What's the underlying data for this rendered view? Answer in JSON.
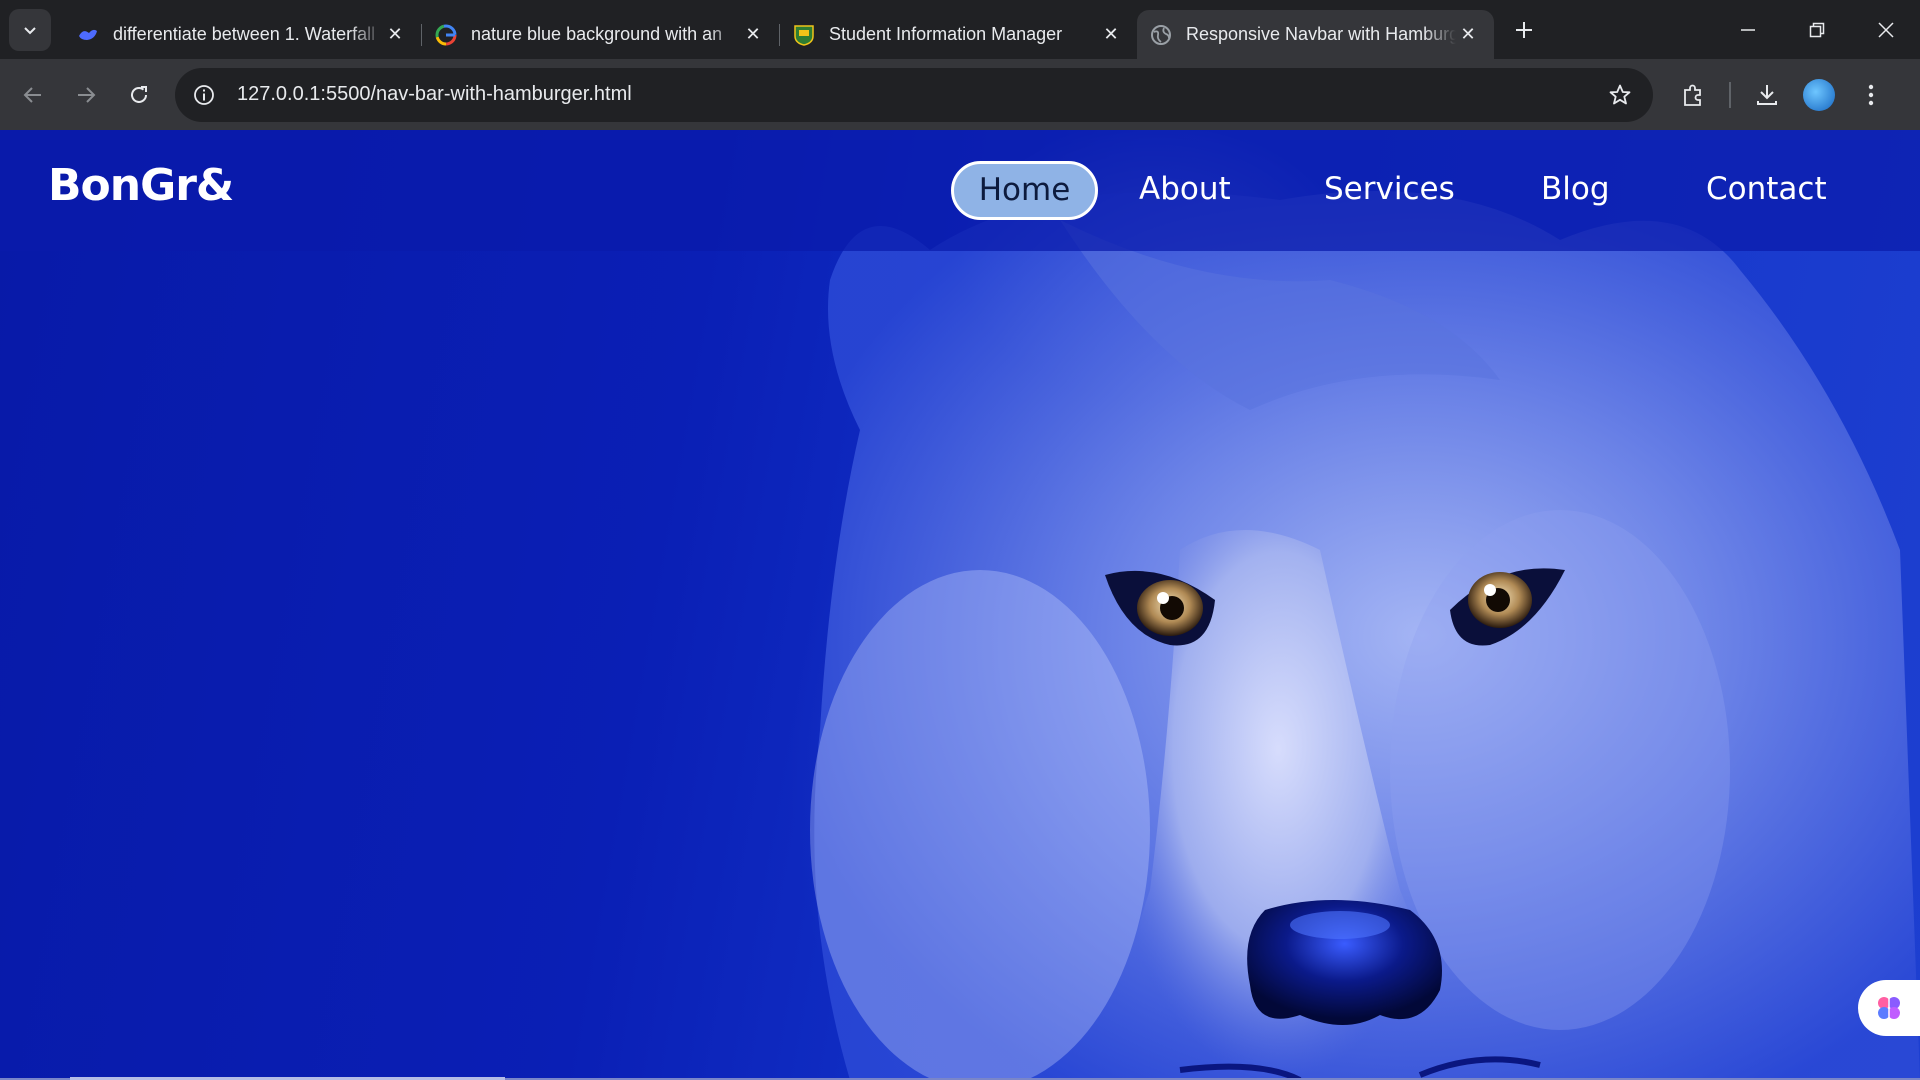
{
  "browser": {
    "tabs": [
      {
        "title": "differentiate between 1. Waterfall",
        "favicon": "whale-icon",
        "active": false
      },
      {
        "title": "nature blue background with an",
        "favicon": "google-icon",
        "active": false
      },
      {
        "title": "Student Information Manager",
        "favicon": "crest-icon",
        "active": false
      },
      {
        "title": "Responsive Navbar with Hamburger",
        "favicon": "globe-icon",
        "active": true
      }
    ],
    "address": {
      "host": "127.0.0.1",
      "path": ":5500/nav-bar-with-hamburger.html"
    }
  },
  "site": {
    "logo": "BonGr&",
    "menu": [
      {
        "label": "Home",
        "active": true
      },
      {
        "label": "About",
        "active": false
      },
      {
        "label": "Services",
        "active": false
      },
      {
        "label": "Blog",
        "active": false
      },
      {
        "label": "Contact",
        "active": false
      }
    ],
    "hero_image": "blue wolf face"
  },
  "colors": {
    "chrome_dark": "#202124",
    "chrome_toolbar": "#35363a",
    "nav_active_bg": "#8fb3e6",
    "page_blue": "#0a1fb5"
  }
}
